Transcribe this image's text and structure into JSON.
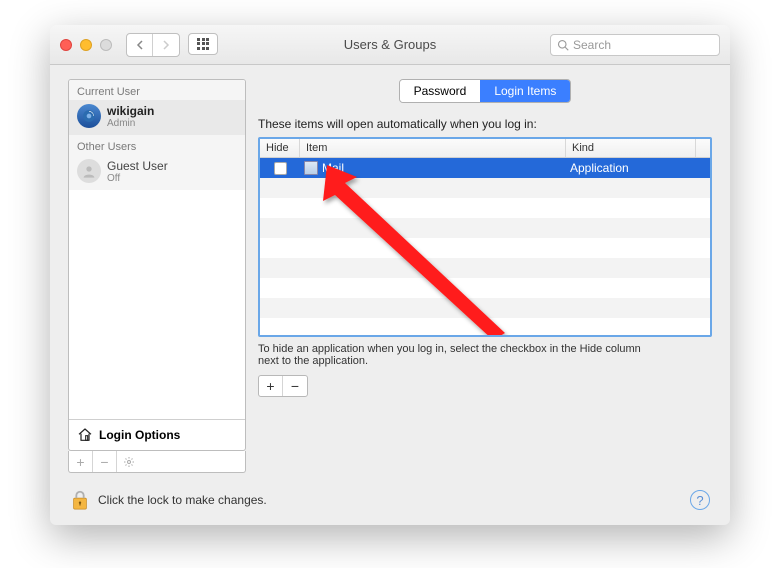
{
  "window": {
    "title": "Users & Groups"
  },
  "search": {
    "placeholder": "Search"
  },
  "sidebar": {
    "current_header": "Current User",
    "other_header": "Other Users",
    "users": [
      {
        "name": "wikigain",
        "role": "Admin",
        "selected": true,
        "type": "admin"
      },
      {
        "name": "Guest User",
        "role": "Off",
        "selected": false,
        "type": "guest"
      }
    ],
    "login_options": "Login Options"
  },
  "tabs": [
    {
      "label": "Password",
      "active": false
    },
    {
      "label": "Login Items",
      "active": true
    }
  ],
  "main": {
    "description": "These items will open automatically when you log in:",
    "columns": {
      "hide": "Hide",
      "item": "Item",
      "kind": "Kind"
    },
    "rows": [
      {
        "hidden": false,
        "name": "Mail",
        "kind": "Application",
        "selected": true
      }
    ],
    "hint": "To hide an application when you log in, select the checkbox in the Hide column next to the application."
  },
  "footer": {
    "lock_text": "Click the lock to make changes."
  }
}
